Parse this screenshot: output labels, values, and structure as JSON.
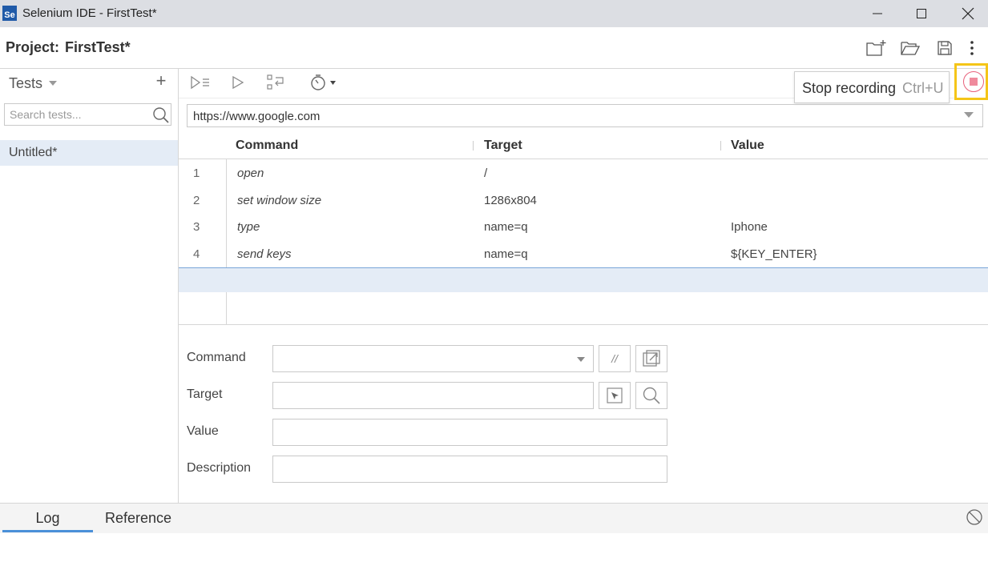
{
  "window": {
    "app_logo_text": "Se",
    "title": "Selenium IDE - FirstTest*"
  },
  "project": {
    "label": "Project:",
    "name": "FirstTest*"
  },
  "sidebar": {
    "title": "Tests",
    "add_label": "+",
    "search_placeholder": "Search tests...",
    "tests": [
      {
        "label": "Untitled*",
        "selected": true
      }
    ]
  },
  "toolbar": {
    "tooltip_text": "Stop recording",
    "tooltip_shortcut": "Ctrl+U",
    "record_color": "#e8607a",
    "highlight_color": "#f5c518"
  },
  "url": {
    "value": "https://www.google.com"
  },
  "table": {
    "headers": [
      "Command",
      "Target",
      "Value"
    ],
    "rows": [
      {
        "num": "1",
        "command": "open",
        "target": "/",
        "value": ""
      },
      {
        "num": "2",
        "command": "set window size",
        "target": "1286x804",
        "value": ""
      },
      {
        "num": "3",
        "command": "type",
        "target": "name=q",
        "value": "Iphone"
      },
      {
        "num": "4",
        "command": "send keys",
        "target": "name=q",
        "value": "${KEY_ENTER}"
      }
    ]
  },
  "editor": {
    "command_label": "Command",
    "target_label": "Target",
    "value_label": "Value",
    "description_label": "Description",
    "comment_button_label": "//"
  },
  "bottom": {
    "tabs": [
      "Log",
      "Reference"
    ],
    "active_tab": "Log",
    "accent": "#4a90d9"
  }
}
